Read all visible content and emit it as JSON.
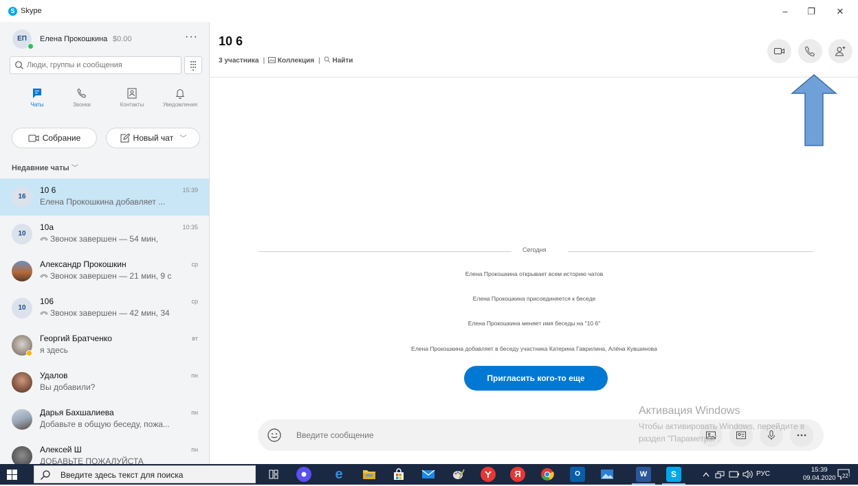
{
  "app": {
    "title": "Skype",
    "logo_letter": "S",
    "minimize": "–",
    "maximize": "❐",
    "close": "✕"
  },
  "profile": {
    "initials": "ЕП",
    "name": "Елена Прокошкина",
    "credit": "$0.00",
    "more": "···"
  },
  "search": {
    "placeholder": "Люди, группы и сообщения"
  },
  "nav": {
    "chats": "Чаты",
    "calls": "Звонки",
    "contacts": "Контакты",
    "notifications": "Уведомления"
  },
  "actions": {
    "meeting": "Собрание",
    "new_chat": "Новый чат"
  },
  "recent_header": "Недавние чаты",
  "chats": [
    {
      "initials": "16",
      "name": "10 6",
      "time": "15:39",
      "preview": "Елена Прокошкина добавляет ...",
      "call": false
    },
    {
      "initials": "10",
      "name": "10а",
      "time": "10:35",
      "preview": "Звонок завершен — 54 мин,",
      "call": true
    },
    {
      "initials": "",
      "name": "Александр Прокошкин",
      "time": "ср",
      "preview": "Звонок завершен — 21 мин, 9 с",
      "call": true
    },
    {
      "initials": "10",
      "name": "106",
      "time": "ср",
      "preview": "Звонок завершен — 42 мин, 34",
      "call": true
    },
    {
      "initials": "",
      "name": "Георгий Братченко",
      "time": "вт",
      "preview": "я здесь",
      "call": false
    },
    {
      "initials": "",
      "name": "Удалов",
      "time": "пн",
      "preview": "Вы добавили?",
      "call": false
    },
    {
      "initials": "",
      "name": "Дарья Бахшалиева",
      "time": "пн",
      "preview": "Добавьте в общую беседу, пожа...",
      "call": false
    },
    {
      "initials": "",
      "name": "Алексей Ш",
      "time": "пн",
      "preview": "ДОБАВЬТЕ ПОЖАЛУЙСТА",
      "call": false
    }
  ],
  "conversation": {
    "title": "10 6",
    "participants": "3 участника",
    "collection": "Коллекция",
    "find": "Найти",
    "day": "Сегодня",
    "messages": [
      "Елена Прокошкина открывает всем историю чатов",
      "Елена Прокошкина присоединяется к беседе",
      "Елена Прокошкина меняет имя беседы на \"10 6\"",
      "Елена Прокошкина добавляет в беседу участника Катерина Гаврилина, Алёна Кувшинова"
    ],
    "invite": "Пригласить кого-то еще"
  },
  "composer": {
    "placeholder": "Введите сообщение"
  },
  "activation": {
    "title": "Активация Windows",
    "line1": "Чтобы активировать Windows, перейдите в",
    "line2": "раздел \"Параметры\"."
  },
  "taskbar": {
    "search_text": "Введите здесь текст для поиска",
    "lang": "РУС",
    "time": "15:39",
    "date": "09.04.2020",
    "notif_count": "22"
  },
  "colors": {
    "accent": "#0078d4",
    "selected_row": "#c9e6f7",
    "arrow": "#6fa0d8",
    "taskbar": "#1b2841"
  }
}
